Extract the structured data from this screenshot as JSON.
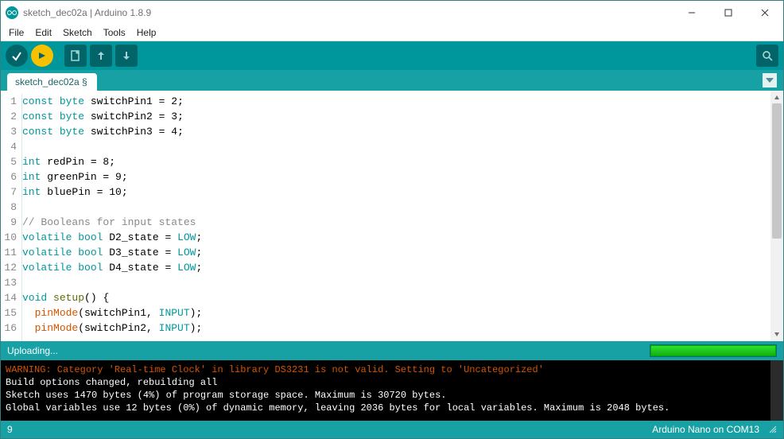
{
  "window": {
    "title": "sketch_dec02a | Arduino 1.8.9"
  },
  "menubar": {
    "items": [
      "File",
      "Edit",
      "Sketch",
      "Tools",
      "Help"
    ]
  },
  "tabs": {
    "active": "sketch_dec02a §"
  },
  "editor": {
    "lines": [
      {
        "n": 1,
        "tokens": [
          [
            "kw-type",
            "const"
          ],
          [
            "",
            " "
          ],
          [
            "kw-type",
            "byte"
          ],
          [
            "",
            " switchPin1 = 2;"
          ]
        ]
      },
      {
        "n": 2,
        "tokens": [
          [
            "kw-type",
            "const"
          ],
          [
            "",
            " "
          ],
          [
            "kw-type",
            "byte"
          ],
          [
            "",
            " switchPin2 = 3;"
          ]
        ]
      },
      {
        "n": 3,
        "tokens": [
          [
            "kw-type",
            "const"
          ],
          [
            "",
            " "
          ],
          [
            "kw-type",
            "byte"
          ],
          [
            "",
            " switchPin3 = 4;"
          ]
        ]
      },
      {
        "n": 4,
        "tokens": [
          [
            "",
            ""
          ]
        ]
      },
      {
        "n": 5,
        "tokens": [
          [
            "kw-type",
            "int"
          ],
          [
            "",
            " redPin = 8;"
          ]
        ]
      },
      {
        "n": 6,
        "tokens": [
          [
            "kw-type",
            "int"
          ],
          [
            "",
            " greenPin = 9;"
          ]
        ]
      },
      {
        "n": 7,
        "tokens": [
          [
            "kw-type",
            "int"
          ],
          [
            "",
            " bluePin = 10;"
          ]
        ]
      },
      {
        "n": 8,
        "tokens": [
          [
            "",
            ""
          ]
        ]
      },
      {
        "n": 9,
        "tokens": [
          [
            "comment",
            "// Booleans for input states"
          ]
        ]
      },
      {
        "n": 10,
        "tokens": [
          [
            "kw-type",
            "volatile"
          ],
          [
            "",
            " "
          ],
          [
            "kw-type",
            "bool"
          ],
          [
            "",
            " D2_state = "
          ],
          [
            "kw-const",
            "LOW"
          ],
          [
            "",
            ";"
          ]
        ]
      },
      {
        "n": 11,
        "tokens": [
          [
            "kw-type",
            "volatile"
          ],
          [
            "",
            " "
          ],
          [
            "kw-type",
            "bool"
          ],
          [
            "",
            " D3_state = "
          ],
          [
            "kw-const",
            "LOW"
          ],
          [
            "",
            ";"
          ]
        ]
      },
      {
        "n": 12,
        "tokens": [
          [
            "kw-type",
            "volatile"
          ],
          [
            "",
            " "
          ],
          [
            "kw-type",
            "bool"
          ],
          [
            "",
            " D4_state = "
          ],
          [
            "kw-const",
            "LOW"
          ],
          [
            "",
            ";"
          ]
        ]
      },
      {
        "n": 13,
        "tokens": [
          [
            "",
            ""
          ]
        ]
      },
      {
        "n": 14,
        "tokens": [
          [
            "kw-type",
            "void"
          ],
          [
            "",
            " "
          ],
          [
            "kw-flow",
            "setup"
          ],
          [
            "",
            "() {"
          ]
        ]
      },
      {
        "n": 15,
        "tokens": [
          [
            "",
            "  "
          ],
          [
            "kw-func",
            "pinMode"
          ],
          [
            "",
            "(switchPin1, "
          ],
          [
            "kw-const",
            "INPUT"
          ],
          [
            "",
            ");"
          ]
        ]
      },
      {
        "n": 16,
        "tokens": [
          [
            "",
            "  "
          ],
          [
            "kw-func",
            "pinMode"
          ],
          [
            "",
            "(switchPin2, "
          ],
          [
            "kw-const",
            "INPUT"
          ],
          [
            "",
            ");"
          ]
        ]
      }
    ]
  },
  "upload": {
    "status": "Uploading...",
    "progress_pct": 100
  },
  "console": {
    "lines": [
      {
        "cls": "warn",
        "text": "WARNING: Category 'Real-time Clock' in library DS3231 is not valid. Setting to 'Uncategorized'"
      },
      {
        "cls": "",
        "text": "Build options changed, rebuilding all"
      },
      {
        "cls": "",
        "text": "Sketch uses 1470 bytes (4%) of program storage space. Maximum is 30720 bytes."
      },
      {
        "cls": "",
        "text": "Global variables use 12 bytes (0%) of dynamic memory, leaving 2036 bytes for local variables. Maximum is 2048 bytes."
      }
    ]
  },
  "bottombar": {
    "left": "9",
    "right": "Arduino Nano on COM13"
  }
}
